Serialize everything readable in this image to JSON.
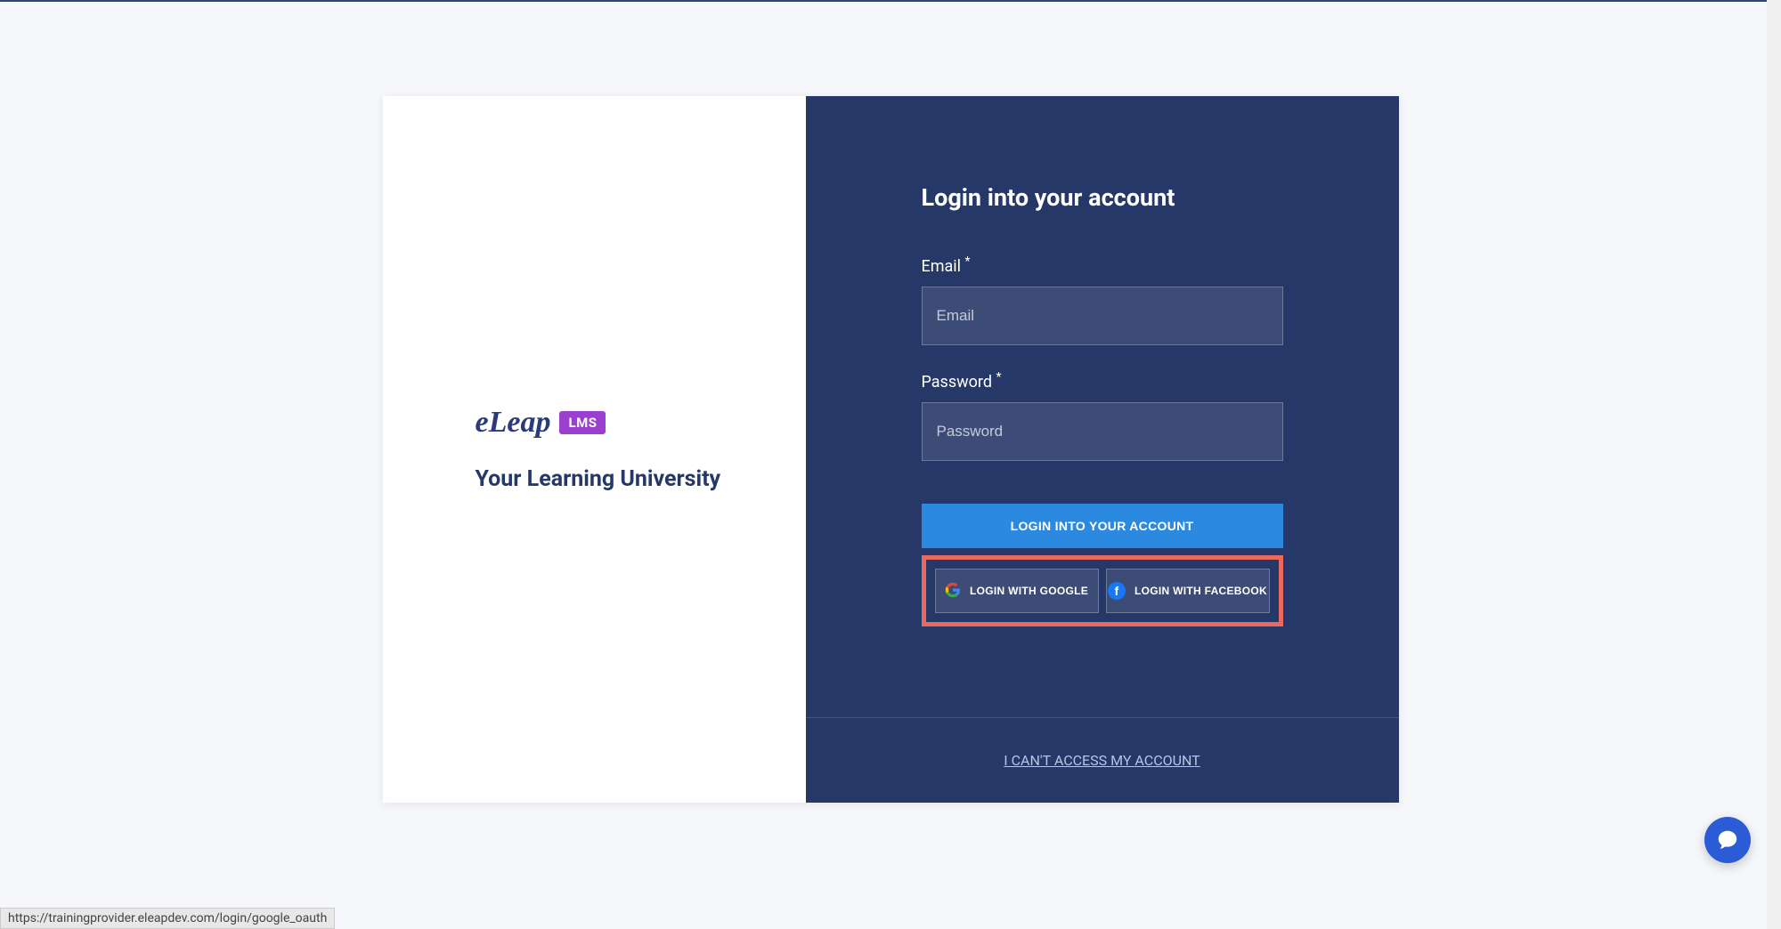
{
  "branding": {
    "logo_text": "eLeap",
    "badge": "LMS",
    "title": "Your Learning University"
  },
  "form": {
    "heading": "Login into your account",
    "email_label": "Email",
    "email_placeholder": "Email",
    "password_label": "Password",
    "password_placeholder": "Password",
    "required_mark": "*",
    "submit_label": "LOGIN INTO YOUR ACCOUNT",
    "google_label": "LOGIN WITH GOOGLE",
    "facebook_label": "LOGIN WITH FACEBOOK"
  },
  "footer": {
    "access_link": "I CAN'T ACCESS MY ACCOUNT"
  },
  "status_bar": {
    "url": "https://trainingprovider.eleapdev.com/login/google_oauth"
  }
}
